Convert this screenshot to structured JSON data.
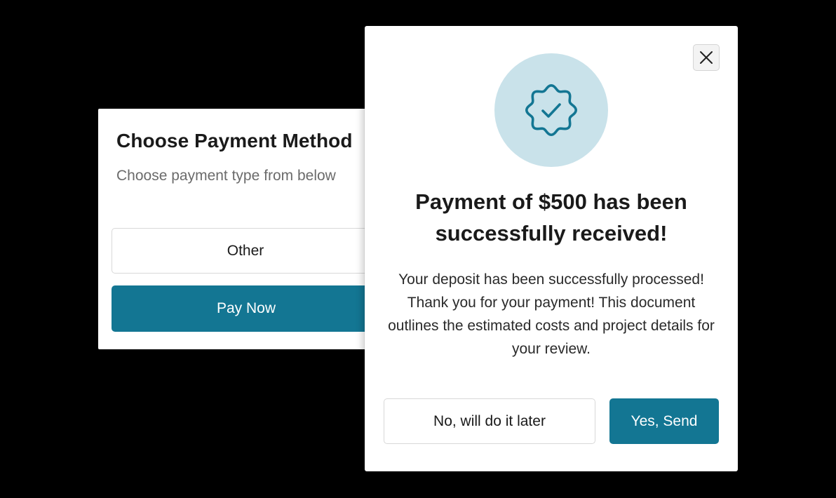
{
  "payment_method_dialog": {
    "title": "Choose Payment Method",
    "subtitle": "Choose payment type from below",
    "other_label": "Other",
    "pay_now_label": "Pay Now"
  },
  "confirmation_dialog": {
    "close_icon": "close-icon",
    "badge_icon": "verified-check-badge-icon",
    "title_line1": "Payment of $500 has been",
    "title_line2": "successfully received!",
    "message": "Your deposit has been successfully processed! Thank you for your payment! This document outlines the estimated costs and project details for your review.",
    "later_label": "No, will do it later",
    "send_label": "Yes, Send"
  },
  "colors": {
    "background": "#000000",
    "accent": "#137693",
    "badge_background": "#c9e2ea"
  }
}
